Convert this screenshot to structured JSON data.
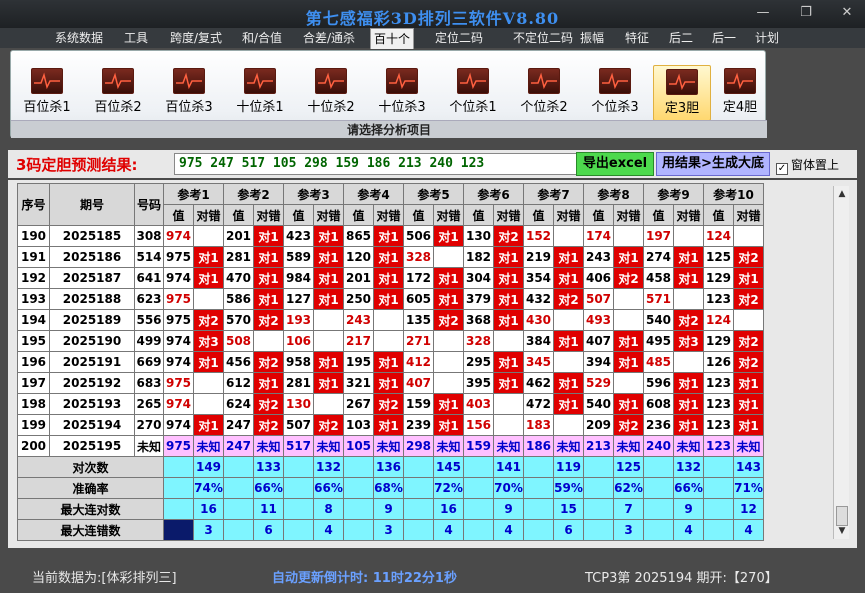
{
  "title": "第七感福彩3D排列三软件V8.80",
  "menu": [
    "系统数据",
    "工具",
    "跨度/复式",
    "和/合值",
    "合差/通杀",
    "百十个",
    "定位二码",
    "不定位二码",
    "振幅",
    "特征",
    "后二",
    "后一",
    "计划"
  ],
  "menu_active": "百十个",
  "ribbon": {
    "buttons": [
      "百位杀1",
      "百位杀2",
      "百位杀3",
      "十位杀1",
      "十位杀2",
      "十位杀3",
      "个位杀1",
      "个位杀2",
      "个位杀3",
      "定3胆",
      "定4胆"
    ],
    "active": "定3胆",
    "caption": "请选择分析项目"
  },
  "result": {
    "label": "3码定胆预测结果:",
    "value": "975 247 517 105 298 159 186 213 240 123",
    "export_label": "导出excel",
    "generate_label": "用结果>生成大底",
    "topmost_label": "窗体置上",
    "topmost_checked": "✓"
  },
  "table": {
    "headers": {
      "idx": "序号",
      "period": "期号",
      "num": "号码",
      "val": "值",
      "hit": "对错"
    },
    "refs": [
      "参考1",
      "参考2",
      "参考3",
      "参考4",
      "参考5",
      "参考6",
      "参考7",
      "参考8",
      "参考9",
      "参考10"
    ],
    "rows": [
      {
        "idx": "190",
        "period": "2025185",
        "num": "308",
        "cells": [
          [
            "974",
            "",
            1
          ],
          [
            "201",
            "对1",
            0
          ],
          [
            "423",
            "对1",
            0
          ],
          [
            "865",
            "对1",
            0
          ],
          [
            "506",
            "对1",
            0
          ],
          [
            "130",
            "对2",
            0
          ],
          [
            "152",
            "",
            1
          ],
          [
            "174",
            "",
            1
          ],
          [
            "197",
            "",
            1
          ],
          [
            "124",
            "",
            1
          ]
        ]
      },
      {
        "idx": "191",
        "period": "2025186",
        "num": "514",
        "cells": [
          [
            "975",
            "对1",
            0
          ],
          [
            "281",
            "对1",
            0
          ],
          [
            "589",
            "对1",
            0
          ],
          [
            "120",
            "对1",
            0
          ],
          [
            "328",
            "",
            1
          ],
          [
            "182",
            "对1",
            0
          ],
          [
            "219",
            "对1",
            0
          ],
          [
            "243",
            "对1",
            0
          ],
          [
            "274",
            "对1",
            0
          ],
          [
            "125",
            "对2",
            0
          ]
        ]
      },
      {
        "idx": "192",
        "period": "2025187",
        "num": "641",
        "cells": [
          [
            "974",
            "对1",
            0
          ],
          [
            "470",
            "对1",
            0
          ],
          [
            "984",
            "对1",
            0
          ],
          [
            "201",
            "对1",
            0
          ],
          [
            "172",
            "对1",
            0
          ],
          [
            "304",
            "对1",
            0
          ],
          [
            "354",
            "对1",
            0
          ],
          [
            "406",
            "对2",
            0
          ],
          [
            "458",
            "对1",
            0
          ],
          [
            "129",
            "对1",
            0
          ]
        ]
      },
      {
        "idx": "193",
        "period": "2025188",
        "num": "623",
        "cells": [
          [
            "975",
            "",
            1
          ],
          [
            "586",
            "对1",
            0
          ],
          [
            "127",
            "对1",
            0
          ],
          [
            "250",
            "对1",
            0
          ],
          [
            "605",
            "对1",
            0
          ],
          [
            "379",
            "对1",
            0
          ],
          [
            "432",
            "对2",
            0
          ],
          [
            "507",
            "",
            1
          ],
          [
            "571",
            "",
            1
          ],
          [
            "123",
            "对2",
            0
          ]
        ]
      },
      {
        "idx": "194",
        "period": "2025189",
        "num": "556",
        "cells": [
          [
            "975",
            "对2",
            0
          ],
          [
            "570",
            "对2",
            0
          ],
          [
            "193",
            "",
            1
          ],
          [
            "243",
            "",
            1
          ],
          [
            "135",
            "对2",
            0
          ],
          [
            "368",
            "对1",
            0
          ],
          [
            "430",
            "",
            1
          ],
          [
            "493",
            "",
            1
          ],
          [
            "540",
            "对2",
            0
          ],
          [
            "124",
            "",
            1
          ]
        ]
      },
      {
        "idx": "195",
        "period": "2025190",
        "num": "499",
        "cells": [
          [
            "974",
            "对3",
            0
          ],
          [
            "508",
            "",
            1
          ],
          [
            "106",
            "",
            1
          ],
          [
            "217",
            "",
            1
          ],
          [
            "271",
            "",
            1
          ],
          [
            "328",
            "",
            1
          ],
          [
            "384",
            "对1",
            0
          ],
          [
            "407",
            "对1",
            0
          ],
          [
            "495",
            "对3",
            0
          ],
          [
            "129",
            "对2",
            0
          ]
        ]
      },
      {
        "idx": "196",
        "period": "2025191",
        "num": "669",
        "cells": [
          [
            "974",
            "对1",
            0
          ],
          [
            "456",
            "对2",
            0
          ],
          [
            "958",
            "对1",
            0
          ],
          [
            "195",
            "对1",
            0
          ],
          [
            "412",
            "",
            1
          ],
          [
            "295",
            "对1",
            0
          ],
          [
            "345",
            "",
            1
          ],
          [
            "394",
            "对1",
            0
          ],
          [
            "485",
            "",
            1
          ],
          [
            "126",
            "对2",
            0
          ]
        ]
      },
      {
        "idx": "197",
        "period": "2025192",
        "num": "683",
        "cells": [
          [
            "975",
            "",
            1
          ],
          [
            "612",
            "对1",
            0
          ],
          [
            "281",
            "对1",
            0
          ],
          [
            "321",
            "对1",
            0
          ],
          [
            "407",
            "",
            1
          ],
          [
            "395",
            "对1",
            0
          ],
          [
            "462",
            "对1",
            0
          ],
          [
            "529",
            "",
            1
          ],
          [
            "596",
            "对1",
            0
          ],
          [
            "123",
            "对1",
            0
          ]
        ]
      },
      {
        "idx": "198",
        "period": "2025193",
        "num": "265",
        "cells": [
          [
            "974",
            "",
            1
          ],
          [
            "624",
            "对2",
            0
          ],
          [
            "130",
            "",
            1
          ],
          [
            "267",
            "对2",
            0
          ],
          [
            "159",
            "对1",
            0
          ],
          [
            "403",
            "",
            1
          ],
          [
            "472",
            "对1",
            0
          ],
          [
            "540",
            "对1",
            0
          ],
          [
            "608",
            "对1",
            0
          ],
          [
            "123",
            "对1",
            0
          ]
        ]
      },
      {
        "idx": "199",
        "period": "2025194",
        "num": "270",
        "cells": [
          [
            "974",
            "对1",
            0
          ],
          [
            "247",
            "对2",
            0
          ],
          [
            "507",
            "对2",
            0
          ],
          [
            "103",
            "对1",
            0
          ],
          [
            "239",
            "对1",
            0
          ],
          [
            "156",
            "",
            1
          ],
          [
            "183",
            "",
            1
          ],
          [
            "209",
            "对2",
            0
          ],
          [
            "236",
            "对1",
            0
          ],
          [
            "123",
            "对1",
            0
          ]
        ]
      }
    ],
    "predict": {
      "idx": "200",
      "period": "2025195",
      "num": "未知",
      "vals": [
        "975",
        "247",
        "517",
        "105",
        "298",
        "159",
        "186",
        "213",
        "240",
        "123"
      ],
      "hit": "未知"
    },
    "stats": [
      {
        "label": "对次数",
        "vals": [
          "149",
          "133",
          "132",
          "136",
          "145",
          "141",
          "119",
          "125",
          "132",
          "143"
        ]
      },
      {
        "label": "准确率",
        "vals": [
          "74%",
          "66%",
          "66%",
          "68%",
          "72%",
          "70%",
          "59%",
          "62%",
          "66%",
          "71%"
        ]
      },
      {
        "label": "最大连对数",
        "vals": [
          "16",
          "11",
          "8",
          "9",
          "16",
          "9",
          "15",
          "7",
          "9",
          "12"
        ]
      },
      {
        "label": "最大连错数",
        "vals": [
          "3",
          "6",
          "4",
          "3",
          "4",
          "4",
          "6",
          "3",
          "4",
          "4"
        ]
      }
    ]
  },
  "status": {
    "current_data": "当前数据为:[体彩排列三]",
    "countdown": "自动更新倒计时: 11时22分1秒",
    "latest": "TCP3第 2025194 期开:【270】"
  },
  "colors": {
    "miss": "#e00000",
    "predict_row": "#ffc0ff",
    "stats_row": "#7ff5ff",
    "accent_title": "#3e8ff0"
  }
}
